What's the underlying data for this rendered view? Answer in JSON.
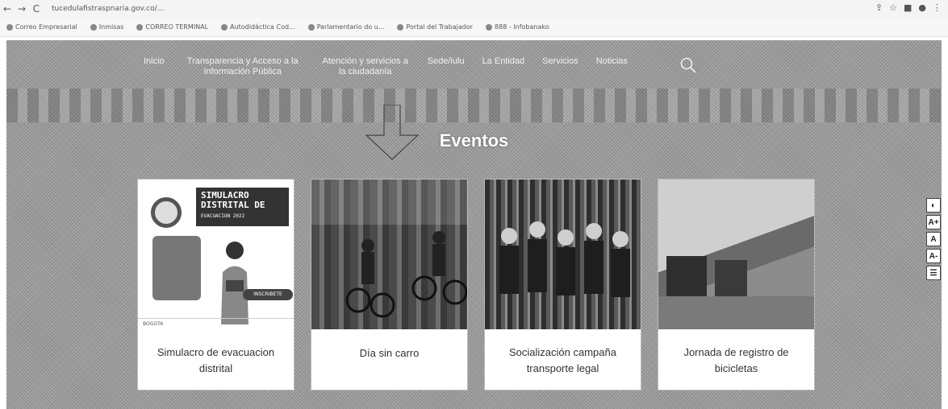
{
  "browser": {
    "url": "tucedulafistraspnaria.gov.co/...",
    "bookmarks": [
      "Correo Empresarial",
      "Inmisas",
      "CORREO TERMINAL",
      "Autodidáctica Cod...",
      "Parlamentario do u...",
      "Portal del Trabajador",
      "888 - Infobanako"
    ]
  },
  "site_nav": {
    "inicio": "Inicio",
    "transparencia": "Transparencia y Acceso a la Información Pública",
    "atencion": "Atención y servicios a la ciudadanía",
    "sede": "Sede/iulu",
    "entidad": "La Entidad",
    "servicios": "Servicios",
    "noticias": "Noticias"
  },
  "section_title": "Eventos",
  "cards": [
    {
      "title": "Simulacro de evacuacion distrital",
      "poster_heading": "SIMULACRO DISTRITAL DE",
      "poster_sub": "EVACUACION 2022",
      "poster_button": "INSCRIBETE",
      "poster_footer": "BOGOTA"
    },
    {
      "title": "Día sin carro"
    },
    {
      "title": "Socialización campaña transporte legal"
    },
    {
      "title": "Jornada de registro de bicicletas"
    }
  ],
  "accessibility": [
    "◐",
    "A+",
    "A",
    "A-",
    "☰"
  ]
}
